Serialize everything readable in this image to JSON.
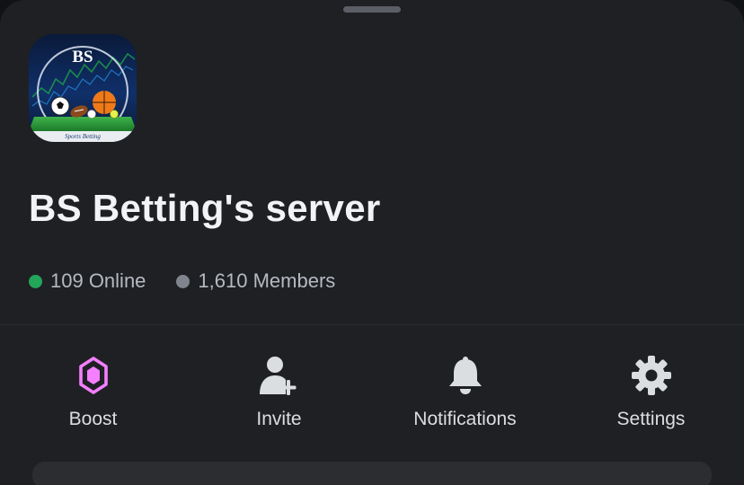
{
  "server": {
    "icon": {
      "logo_text": "BS",
      "banner_text": "Sports Betting"
    },
    "name": "BS Betting's server",
    "stats": {
      "online": "109 Online",
      "members": "1,610 Members",
      "online_color": "#23a55a",
      "members_color": "#80848e"
    }
  },
  "actions": [
    {
      "label": "Boost",
      "icon": "boost-gem-icon",
      "color": "#f47fff"
    },
    {
      "label": "Invite",
      "icon": "add-user-icon",
      "color": "#dbdee1"
    },
    {
      "label": "Notifications",
      "icon": "bell-icon",
      "color": "#dbdee1"
    },
    {
      "label": "Settings",
      "icon": "gear-icon",
      "color": "#dbdee1"
    }
  ],
  "theme": {
    "background": "#1f2024",
    "text_primary": "#f2f3f5",
    "text_secondary": "#b5bac1"
  }
}
